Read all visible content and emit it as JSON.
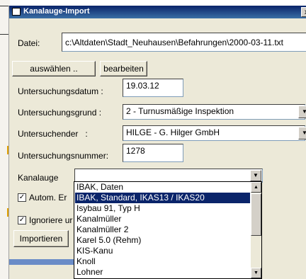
{
  "window": {
    "title": "Kanalauge-Import",
    "close_glyph": "x"
  },
  "form": {
    "datei_label": "Datei:",
    "datei_value": "c:\\Altdaten\\Stadt_Neuhausen\\Befahrungen\\2000-03-11.txt",
    "auswaehlen_label": "auswählen ..",
    "bearbeiten_label": "bearbeiten",
    "datum_label": "Untersuchungsdatum :",
    "datum_value": "19.03.12",
    "grund_label": "Untersuchungsgrund :",
    "grund_value": "2 - Turnusmäßige Inspektion",
    "untersuchender_label": "Untersuchender   :",
    "untersuchender_value": "HILGE - G. Hilger GmbH",
    "nummer_label": "Untersuchungsnummer:",
    "nummer_value": "1278",
    "kanalauge_label": "Kanalauge",
    "kanalauge_value": "",
    "autom_label": "Autom. Er",
    "ignoriere_label": "Ignoriere ur",
    "importieren_label": "Importieren",
    "check_glyph": "✓"
  },
  "dropdown": {
    "items": [
      "IBAK, Daten",
      "IBAK, Standard, IKAS13 / IKAS20",
      "Isybau 91, Typ H",
      "Kanalmüller",
      "Kanalmüller 2",
      "Karel 5.0 (Rehm)",
      "KIS-Kanu",
      "Knoll",
      "Lohner"
    ],
    "selected_index": 1
  },
  "colors": {
    "selection": "#0a246a",
    "dialog_bg": "#ece9d8"
  }
}
